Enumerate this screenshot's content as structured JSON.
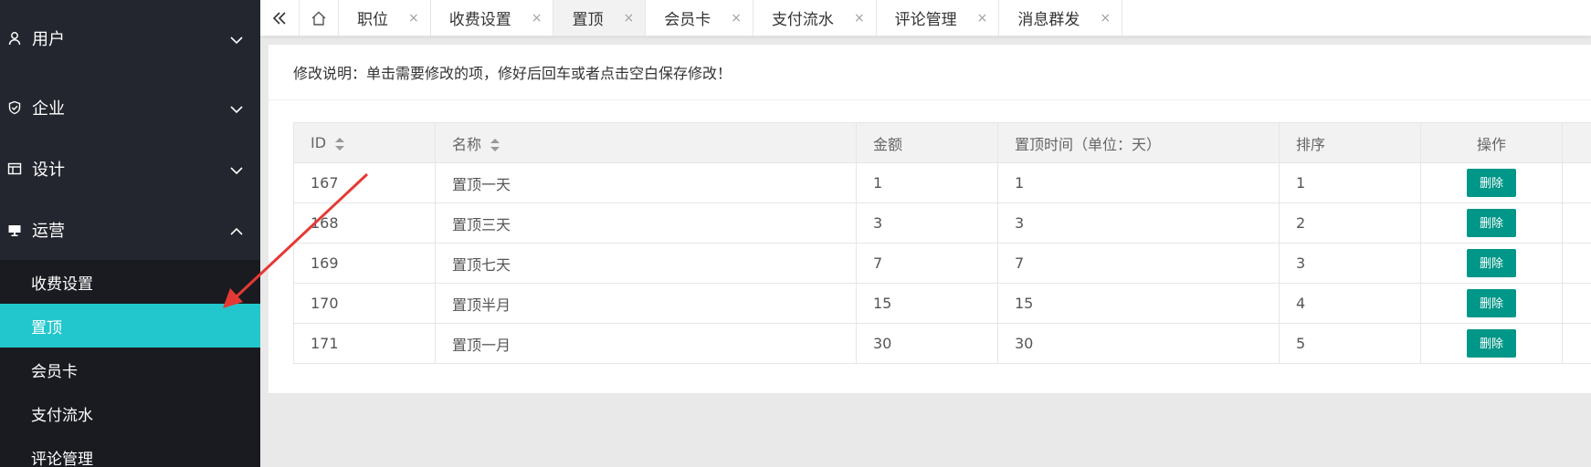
{
  "sidebar": {
    "groups": [
      {
        "label": "用户",
        "icon": "user-icon",
        "expanded": false
      },
      {
        "label": "企业",
        "icon": "shield-icon",
        "expanded": false
      },
      {
        "label": "设计",
        "icon": "window-icon",
        "expanded": false
      },
      {
        "label": "运营",
        "icon": "monitor-icon",
        "expanded": true
      }
    ],
    "sub_items": [
      {
        "label": "收费设置",
        "active": false
      },
      {
        "label": "置顶",
        "active": true
      },
      {
        "label": "会员卡",
        "active": false
      },
      {
        "label": "支付流水",
        "active": false
      },
      {
        "label": "评论管理",
        "active": false
      }
    ]
  },
  "tabbar": {
    "back_icon": "double-chevron-left-icon",
    "home_icon": "home-icon",
    "close_glyph": "×",
    "tabs": [
      {
        "label": "职位",
        "active": false
      },
      {
        "label": "收费设置",
        "active": false
      },
      {
        "label": "置顶",
        "active": true
      },
      {
        "label": "会员卡",
        "active": false
      },
      {
        "label": "支付流水",
        "active": false
      },
      {
        "label": "评论管理",
        "active": false
      },
      {
        "label": "消息群发",
        "active": false
      }
    ]
  },
  "main": {
    "notice": "修改说明：单击需要修改的项，修好后回车或者点击空白保存修改！",
    "table": {
      "columns": [
        "ID",
        "名称",
        "金额",
        "置顶时间（单位：天）",
        "排序",
        "操作"
      ],
      "rows": [
        {
          "id": "167",
          "name": "置顶一天",
          "amount": "1",
          "days": "1",
          "sort": "1",
          "action": "删除"
        },
        {
          "id": "168",
          "name": "置顶三天",
          "amount": "3",
          "days": "3",
          "sort": "2",
          "action": "删除"
        },
        {
          "id": "169",
          "name": "置顶七天",
          "amount": "7",
          "days": "7",
          "sort": "3",
          "action": "删除"
        },
        {
          "id": "170",
          "name": "置顶半月",
          "amount": "15",
          "days": "15",
          "sort": "4",
          "action": "删除"
        },
        {
          "id": "171",
          "name": "置顶一月",
          "amount": "30",
          "days": "30",
          "sort": "5",
          "action": "删除"
        }
      ]
    }
  },
  "colors": {
    "sidebar_bg": "#23262e",
    "active_item": "#22c7cd",
    "delete_button": "#009688",
    "annotation_arrow": "#e53935"
  }
}
